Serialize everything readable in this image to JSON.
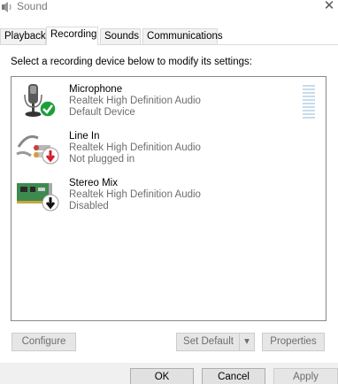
{
  "window": {
    "title": "Sound",
    "close_icon": "close-icon"
  },
  "tabs": [
    {
      "label": "Playback"
    },
    {
      "label": "Recording",
      "active": true
    },
    {
      "label": "Sounds"
    },
    {
      "label": "Communications"
    }
  ],
  "instructions": "Select a recording device below to modify its settings:",
  "devices": [
    {
      "name": "Microphone",
      "driver": "Realtek High Definition Audio",
      "status": "Default Device",
      "icon": "microphone-icon",
      "badge": "green-check-badge"
    },
    {
      "name": "Line In",
      "driver": "Realtek High Definition Audio",
      "status": "Not plugged in",
      "icon": "line-in-cable-icon",
      "badge": "red-down-arrow-badge"
    },
    {
      "name": "Stereo Mix",
      "driver": "Realtek High Definition Audio",
      "status": "Disabled",
      "icon": "sound-card-icon",
      "badge": "black-down-arrow-badge"
    }
  ],
  "buttons": {
    "configure": "Configure",
    "set_default": "Set Default",
    "properties": "Properties",
    "ok": "OK",
    "cancel": "Cancel",
    "apply": "Apply"
  },
  "colors": {
    "tab_border": "#d9d9d9",
    "list_border": "#828790",
    "disabled_text": "#6d6d6d",
    "meter": "#c7dceb",
    "check_green": "#1e9e3a",
    "arrow_red": "#d4202a"
  }
}
